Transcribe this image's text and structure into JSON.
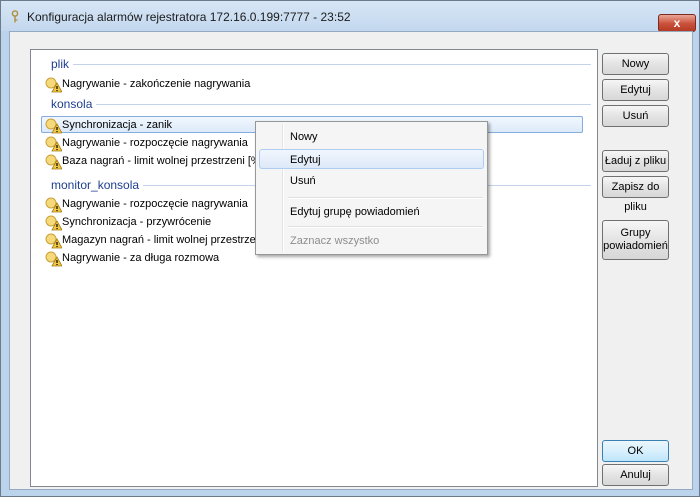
{
  "window": {
    "title": "Konfiguracja alarmów rejestratora 172.16.0.199:7777 - 23:52",
    "close_label": "x"
  },
  "groups": [
    {
      "label": "plik",
      "items": [
        "Nagrywanie - zakończenie nagrywania"
      ]
    },
    {
      "label": "konsola",
      "items": [
        "Synchronizacja - zanik",
        "Nagrywanie - rozpoczęcie nagrywania",
        "Baza nagrań - limit wolnej przestrzeni [%]"
      ]
    },
    {
      "label": "monitor_konsola",
      "items": [
        "Nagrywanie - rozpoczęcie nagrywania",
        "Synchronizacja - przywrócenie",
        "Magazyn nagrań - limit wolnej przestrzeni",
        "Nagrywanie - za długa rozmowa"
      ]
    }
  ],
  "buttons": {
    "nowy": "Nowy",
    "edytuj": "Edytuj",
    "usun": "Usuń",
    "laduj": "Ładuj z pliku",
    "zapisz": "Zapisz do pliku",
    "grupy_line1": "Grupy",
    "grupy_line2": "powiadomień",
    "ok": "OK",
    "anuluj": "Anuluj"
  },
  "context_menu": {
    "nowy": "Nowy",
    "edytuj": "Edytuj",
    "usun": "Usuń",
    "edytuj_grupe": "Edytuj grupę powiadomień",
    "zaznacz": "Zaznacz wszystko"
  },
  "colors": {
    "group_header": "#1e3e8e",
    "selection": "#dceaf9",
    "warning_icon": "#f2c744"
  },
  "icons": {
    "title": "key-icon",
    "alarm": "warning-icon"
  }
}
